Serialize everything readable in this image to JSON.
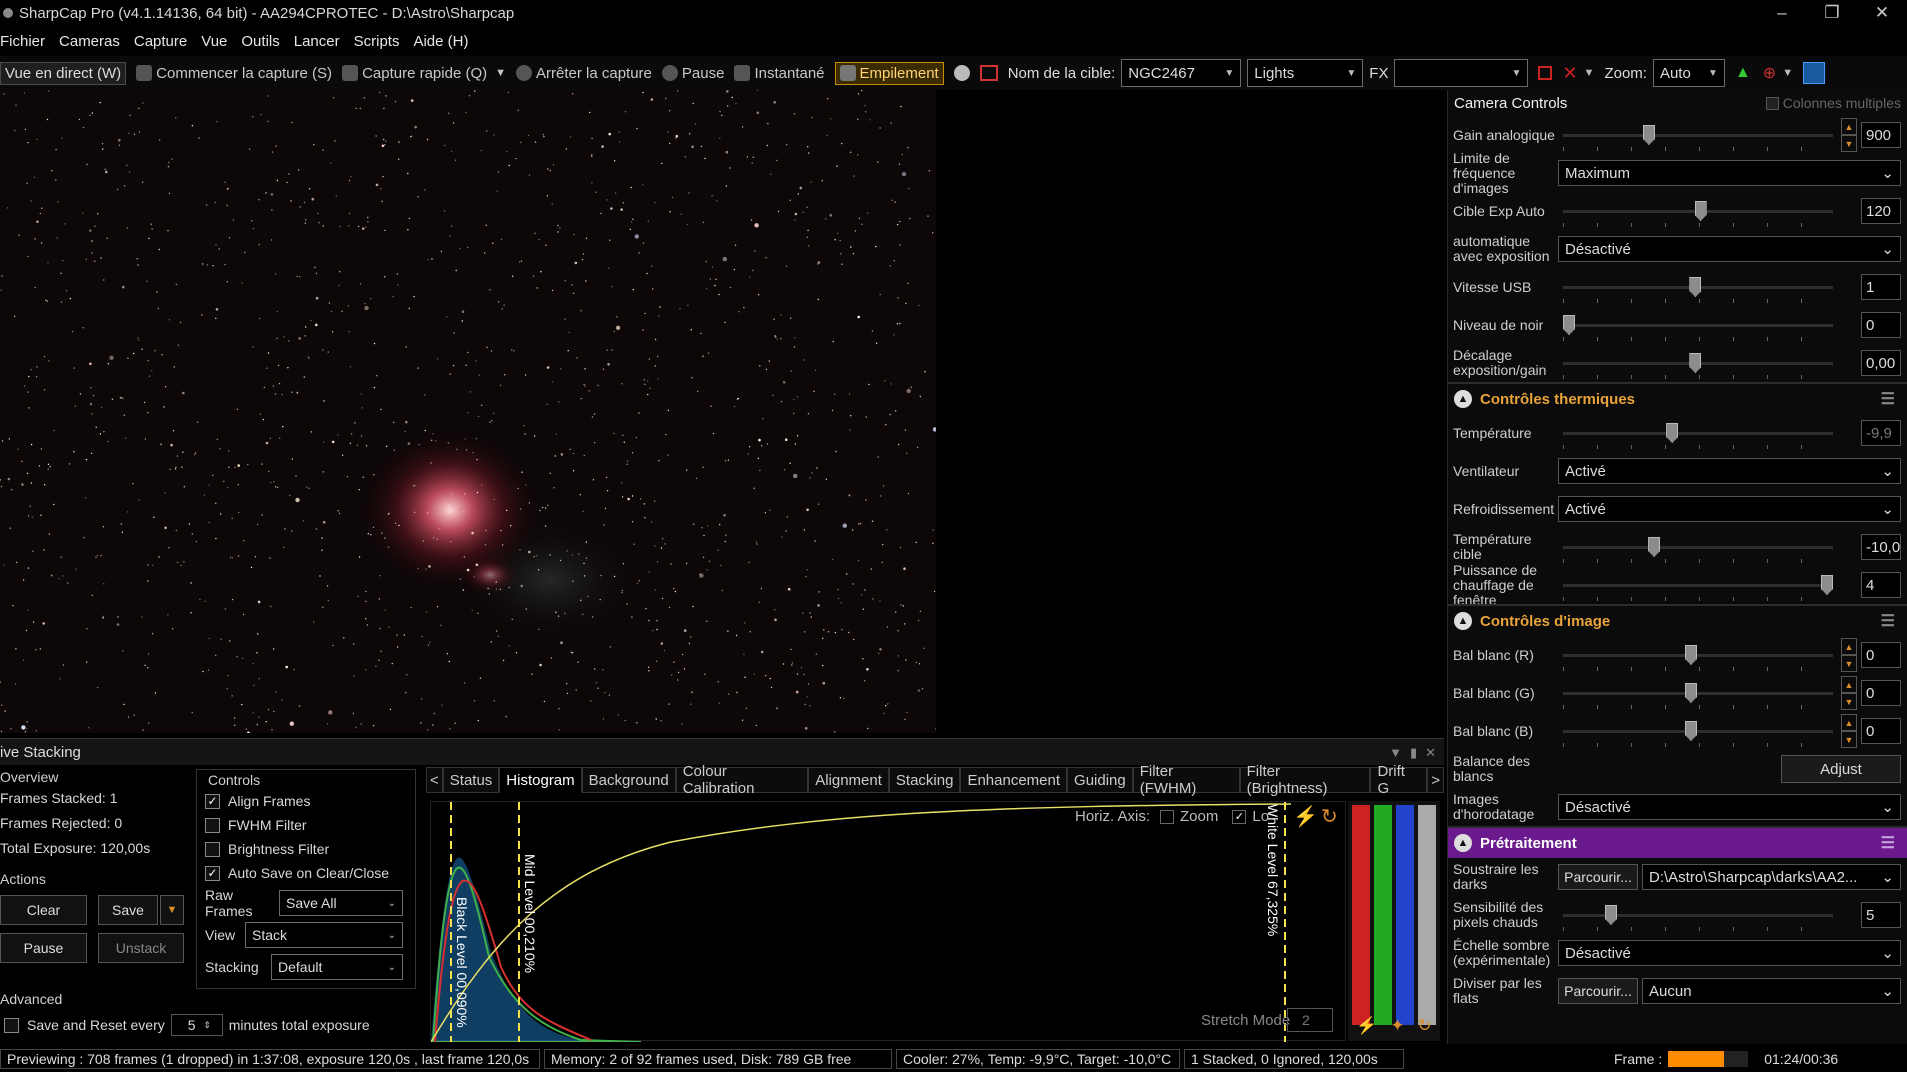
{
  "window": {
    "title": "SharpCap Pro (v4.1.14136, 64 bit) - AA294CPROTEC - D:\\Astro\\Sharpcap",
    "minimize": "–",
    "maximize": "❐",
    "close": "✕"
  },
  "menu": [
    "Fichier",
    "Cameras",
    "Capture",
    "Vue",
    "Outils",
    "Lancer",
    "Scripts",
    "Aide (H)"
  ],
  "toolbar": {
    "live": "Vue en direct (W)",
    "start_capture": "Commencer la capture (S)",
    "quick_capture": "Capture rapide (Q)",
    "stop_capture": "Arrêter la capture",
    "pause": "Pause",
    "snapshot": "Instantané",
    "stacking": "Empilement",
    "target_label": "Nom de la cible:",
    "target_value": "NGC2467",
    "frame_type": "Lights",
    "fx_label": "FX",
    "fx_value": "",
    "zoom_label": "Zoom:",
    "zoom_value": "Auto"
  },
  "camera_controls": {
    "title": "Camera Controls",
    "multi_columns": "Colonnes multiples",
    "rows": [
      {
        "label": "Gain analogique",
        "type": "slider",
        "value": "900",
        "level": 0.31
      },
      {
        "label": "Limite de fréquence d'images",
        "type": "dropdown",
        "value": "Maximum"
      },
      {
        "label": "Cible Exp Auto",
        "type": "slider",
        "value": "120",
        "level": 0.51
      },
      {
        "label": "automatique avec exposition",
        "type": "dropdown",
        "value": "Désactivé"
      },
      {
        "label": "Vitesse USB",
        "type": "slider",
        "value": "1",
        "level": 0.49
      },
      {
        "label": "Niveau de noir",
        "type": "slider",
        "value": "0",
        "level": 0.0
      },
      {
        "label": "Décalage exposition/gain",
        "type": "slider",
        "value": "0,00",
        "level": 0.49
      }
    ]
  },
  "thermal": {
    "title": "Contrôles thermiques",
    "temperature_label": "Température",
    "temperature_value": "-9,9",
    "temperature_level": 0.4,
    "fan_label": "Ventilateur",
    "fan_value": "Activé",
    "cooling_label": "Refroidissement",
    "cooling_value": "Activé",
    "target_temp_label": "Température cible",
    "target_temp_value": "-10,0",
    "target_temp_level": 0.33,
    "heater_label": "Puissance de chauffage de fenêtre",
    "heater_value": "4",
    "heater_level": 1.0
  },
  "image_controls": {
    "title": "Contrôles d'image",
    "wb_r_label": "Bal blanc (R)",
    "wb_r_value": "0",
    "wb_g_label": "Bal blanc (G)",
    "wb_g_value": "0",
    "wb_b_label": "Bal blanc (B)",
    "wb_b_value": "0",
    "wb_balance_label": "Balance des blancs",
    "adjust": "Adjust",
    "timestamp_label": "Images d'horodatage",
    "timestamp_value": "Désactivé"
  },
  "preprocessing": {
    "title": "Prétraitement",
    "darks_label": "Soustraire les darks",
    "browse": "Parcourir...",
    "darks_value": "D:\\Astro\\Sharpcap\\darks\\AA2...",
    "hotpixel_label": "Sensibilité des pixels chauds",
    "hotpixel_value": "5",
    "darkscale_label": "Échelle sombre (expérimentale)",
    "darkscale_value": "Désactivé",
    "flats_label": "Diviser par les flats",
    "flats_value": "Aucun"
  },
  "stacking": {
    "title": "ive Stacking",
    "overview_title": "Overview",
    "frames_stacked": "Frames Stacked:   1",
    "frames_rejected": "Frames Rejected: 0",
    "total_exposure": "Total Exposure:    120,00s",
    "actions_title": "Actions",
    "clear": "Clear",
    "save": "Save",
    "pause": "Pause",
    "unstack": "Unstack",
    "advanced_title": "Advanced",
    "save_reset_label": "Save and Reset every",
    "save_reset_value": "5",
    "save_reset_suffix": "minutes total exposure",
    "controls_title": "Controls",
    "align_frames": "Align Frames",
    "fwhm_filter": "FWHM Filter",
    "brightness_filter": "Brightness Filter",
    "auto_save": "Auto Save on Clear/Close",
    "raw_frames_label": "Raw Frames",
    "raw_frames_value": "Save All",
    "view_label": "View",
    "view_value": "Stack",
    "stacking_label": "Stacking",
    "stacking_value": "Default",
    "tabs": [
      "Status",
      "Histogram",
      "Background",
      "Colour Calibration",
      "Alignment",
      "Stacking",
      "Enhancement",
      "Guiding",
      "Filter (FWHM)",
      "Filter (Brightness)",
      "Drift G"
    ],
    "horiz_axis": "Horiz. Axis:",
    "zoom": "Zoom",
    "log": "Lo",
    "black_level": "Black Level  00,090%",
    "mid_level": "Mid Level  00,210%",
    "white_level": "White Level  67,325%",
    "stretch_mode": "Stretch Mode",
    "stretch_value": "2"
  },
  "status": {
    "preview": "Previewing : 708 frames (1 dropped) in 1:37:08, exposure 120,0s , last frame 120,0s",
    "memory": "Memory: 2 of 92 frames used, Disk: 789 GB free",
    "cooler": "Cooler: 27%, Temp: -9,9°C, Target: -10,0°C",
    "stacked": "1 Stacked, 0 Ignored, 120,00s",
    "frame_label": "Frame :",
    "frame_progress": 0.7,
    "time": "01:24/00:36"
  },
  "colors": {
    "accent": "#e8a33a",
    "purple": "#6a1a8c",
    "orange": "#ff8c00"
  }
}
